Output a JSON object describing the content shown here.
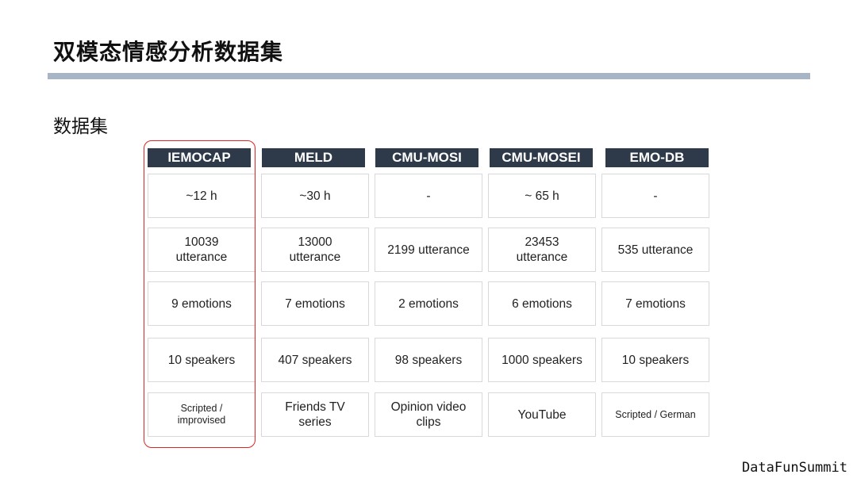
{
  "slide": {
    "title": "双模态情感分析数据集",
    "subtitle": "数据集",
    "brand": "DataFunSummit"
  },
  "table": {
    "headers": [
      "IEMOCAP",
      "MELD",
      "CMU-MOSI",
      "CMU-MOSEI",
      "EMO-DB"
    ],
    "rows": [
      [
        "~12 h",
        "~30 h",
        "-",
        "~ 65 h",
        "-"
      ],
      [
        "10039\nutterance",
        "13000\nutterance",
        "2199 utterance",
        "23453\nutterance",
        "535 utterance"
      ],
      [
        "9 emotions",
        "7 emotions",
        "2 emotions",
        "6 emotions",
        "7 emotions"
      ],
      [
        "10 speakers",
        "407 speakers",
        "98 speakers",
        "1000 speakers",
        "10 speakers"
      ],
      [
        "Scripted /\nimprovised",
        "Friends TV\nseries",
        "Opinion video\nclips",
        "YouTube",
        "Scripted / German"
      ]
    ]
  },
  "colors": {
    "header_bg": "#2e3a4a",
    "highlight": "#e02424",
    "rule": "#a9b5c6"
  }
}
